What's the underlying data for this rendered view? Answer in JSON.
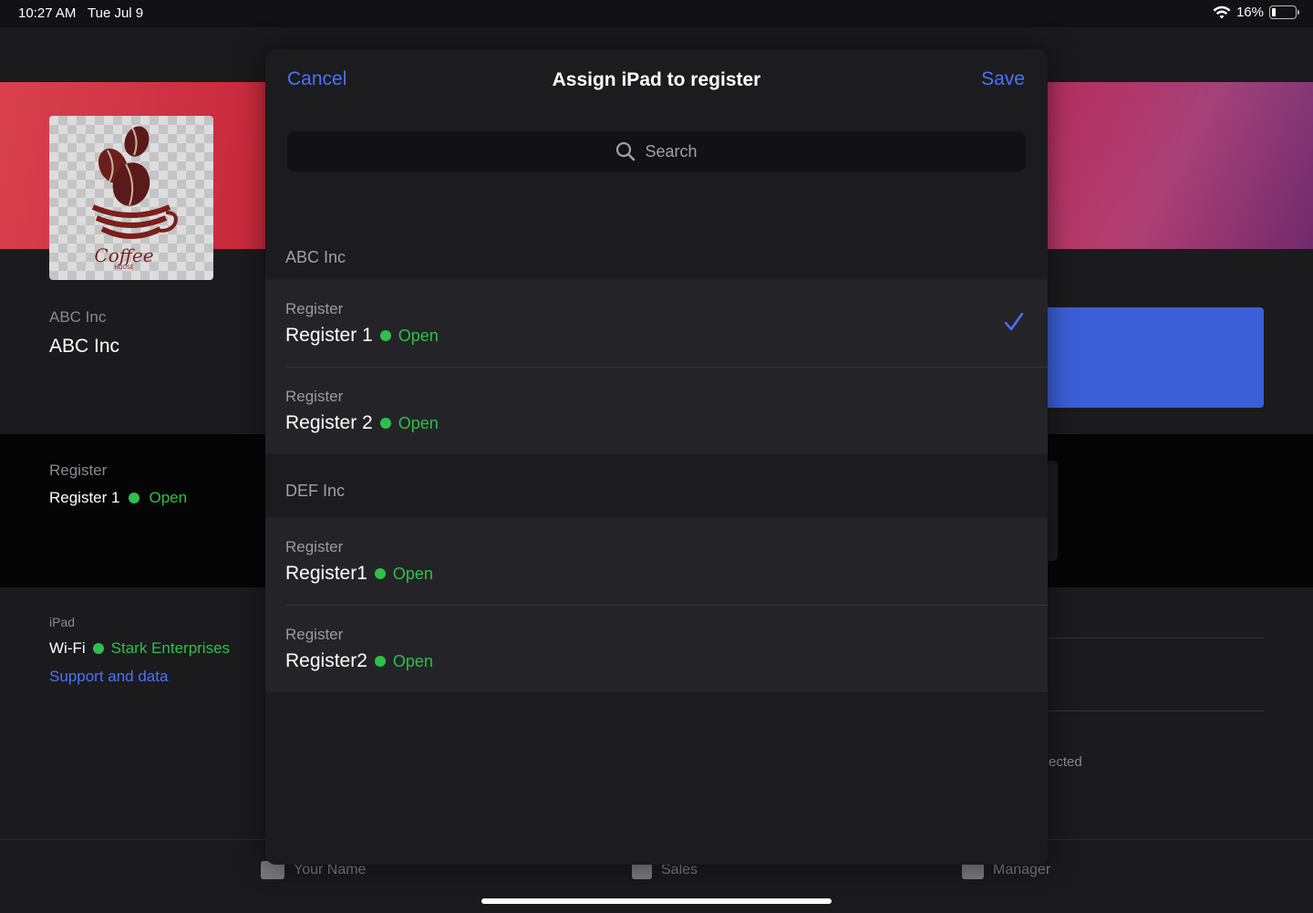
{
  "status_bar": {
    "time": "10:27 AM",
    "date": "Tue Jul 9",
    "battery": "16%",
    "battery_level": 0.16
  },
  "background": {
    "company_label": "ABC Inc",
    "company_name": "ABC Inc",
    "register_label": "Register",
    "register_name": "Register 1",
    "register_status": "Open",
    "ipad_label": "iPad",
    "wifi_label": "Wi-Fi",
    "wifi_network": "Stark Enterprises",
    "support_link": "Support and data",
    "partial_text": "ected",
    "logo_text": "Coffee",
    "logo_subtext": "HOUSE"
  },
  "tab_bar": {
    "items": [
      {
        "label": "Your Name"
      },
      {
        "label": "Sales"
      },
      {
        "label": "Manager"
      }
    ]
  },
  "modal": {
    "title": "Assign iPad to register",
    "cancel_label": "Cancel",
    "save_label": "Save",
    "search_placeholder": "Search",
    "sections": [
      {
        "header": "ABC Inc",
        "items": [
          {
            "caption": "Register",
            "name": "Register 1",
            "status": "Open",
            "selected": true
          },
          {
            "caption": "Register",
            "name": "Register 2",
            "status": "Open",
            "selected": false
          }
        ]
      },
      {
        "header": "DEF Inc",
        "items": [
          {
            "caption": "Register",
            "name": "Register1",
            "status": "Open",
            "selected": false
          },
          {
            "caption": "Register",
            "name": "Register2",
            "status": "Open",
            "selected": false
          }
        ]
      }
    ]
  },
  "colors": {
    "accent": "#4a72ff",
    "status_open": "#2fc04a"
  }
}
